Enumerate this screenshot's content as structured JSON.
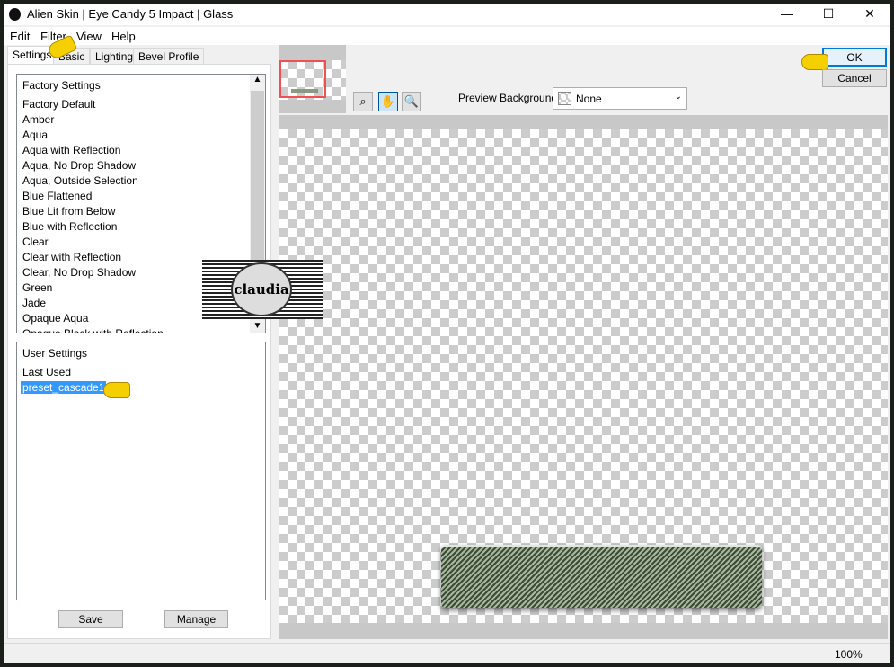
{
  "window": {
    "title": "Alien Skin | Eye Candy 5 Impact | Glass",
    "minimize": "—",
    "maximize": "☐",
    "close": "✕"
  },
  "menu": [
    "Edit",
    "Filter",
    "View",
    "Help"
  ],
  "tabs": [
    "Settings",
    "Basic",
    "Lighting",
    "Bevel Profile"
  ],
  "factory": {
    "header": "Factory Settings",
    "items": [
      "Factory Default",
      "Amber",
      "Aqua",
      "Aqua with Reflection",
      "Aqua, No Drop Shadow",
      "Aqua, Outside Selection",
      "Blue Flattened",
      "Blue Lit from Below",
      "Blue with Reflection",
      "Clear",
      "Clear with Reflection",
      "Clear, No Drop Shadow",
      "Green",
      "Jade",
      "Opaque Aqua",
      "Opaque Black with Reflection"
    ]
  },
  "user": {
    "header": "User Settings",
    "items": [
      "Last Used",
      "preset_cascade1"
    ],
    "selected": "preset_cascade1"
  },
  "buttons": {
    "save": "Save",
    "manage": "Manage",
    "ok": "OK",
    "cancel": "Cancel"
  },
  "preview": {
    "label": "Preview Background:",
    "value": "None"
  },
  "watermark": "claudia",
  "status": {
    "zoom": "100%"
  },
  "colors": {
    "selection": "#3399ff",
    "glass": "#a7b89b"
  }
}
